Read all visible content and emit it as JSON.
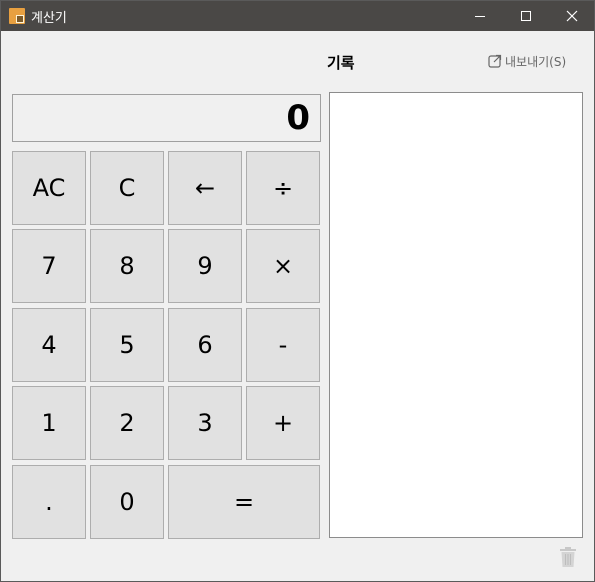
{
  "window": {
    "title": "계산기",
    "controls": {
      "minimize": "minimize",
      "maximize": "maximize",
      "close": "close"
    }
  },
  "history": {
    "title": "기록",
    "export_label": "내보내기(S)"
  },
  "display": {
    "value": "0"
  },
  "keys": {
    "ac": "AC",
    "c": "C",
    "back": "←",
    "divide": "÷",
    "seven": "7",
    "eight": "8",
    "nine": "9",
    "multiply": "×",
    "four": "4",
    "five": "5",
    "six": "6",
    "minus": "-",
    "one": "1",
    "two": "2",
    "three": "3",
    "plus": "+",
    "dot": ".",
    "zero": "0",
    "equals": "="
  },
  "icons": {
    "app": "calculator-icon",
    "export": "export-icon",
    "trash": "trash-icon"
  },
  "colors": {
    "titlebar": "#4a4846",
    "key_bg": "#e1e1e1",
    "key_border": "#adadad",
    "window_bg": "#f0f0f0"
  }
}
